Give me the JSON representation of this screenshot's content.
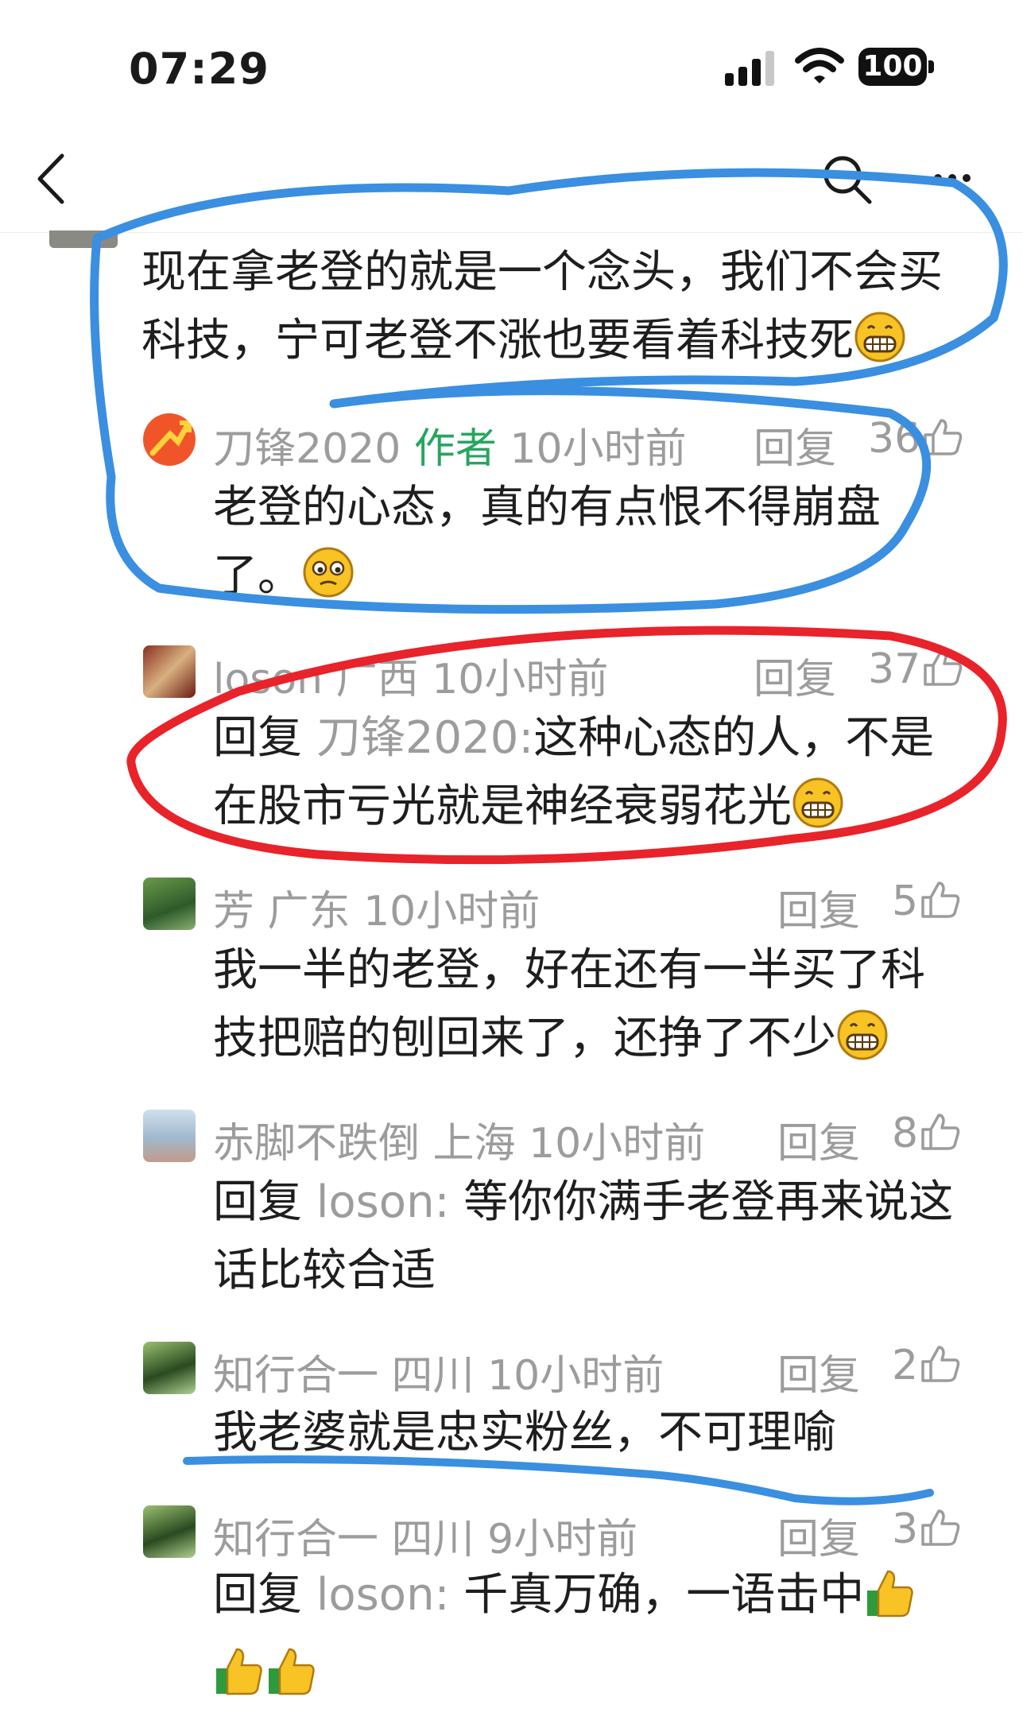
{
  "status": {
    "time": "07:29",
    "battery": "100"
  },
  "post": {
    "text_line1": "现在拿老登的就是一个念头，我们不会买",
    "text_line2": "科技，宁可老登不涨也要看着科技死"
  },
  "comments": [
    {
      "name": "刀锋2020",
      "badge": "作者",
      "location": "",
      "time": "10小时前",
      "reply": "回复",
      "likes": "36",
      "line1": "老登的心态，真的有点恨不得崩盘",
      "line2": "了。"
    },
    {
      "name": "loson",
      "location": "广西",
      "time": "10小时前",
      "reply": "回复",
      "likes": "37",
      "reply_prefix": "回复",
      "reply_target": "刀锋2020:",
      "line1": "这种心态的人，不是",
      "line2": "在股市亏光就是神经衰弱花光"
    },
    {
      "name": "芳",
      "location": "广东",
      "time": "10小时前",
      "reply": "回复",
      "likes": "5",
      "line1": "我一半的老登，好在还有一半买了科",
      "line2": "技把赔的刨回来了，还挣了不少"
    },
    {
      "name": "赤脚不跌倒",
      "location": "上海",
      "time": "10小时前",
      "reply": "回复",
      "likes": "8",
      "reply_prefix": "回复",
      "reply_target": "loson:",
      "line1": "等你你满手老登再来说这",
      "line2": "话比较合适"
    },
    {
      "name": "知行合一",
      "location": "四川",
      "time": "10小时前",
      "reply": "回复",
      "likes": "2",
      "line1": "我老婆就是忠实粉丝，不可理喻"
    },
    {
      "name": "知行合一",
      "location": "四川",
      "time": "9小时前",
      "reply": "回复",
      "likes": "3",
      "reply_prefix": "回复",
      "reply_target": "loson:",
      "line1": "千真万确，一语击中"
    }
  ],
  "colors": {
    "annotation_blue": "#3a8fe0",
    "annotation_red": "#e8232a",
    "author_green": "#27a560",
    "meta_gray": "#9c9c9c"
  }
}
